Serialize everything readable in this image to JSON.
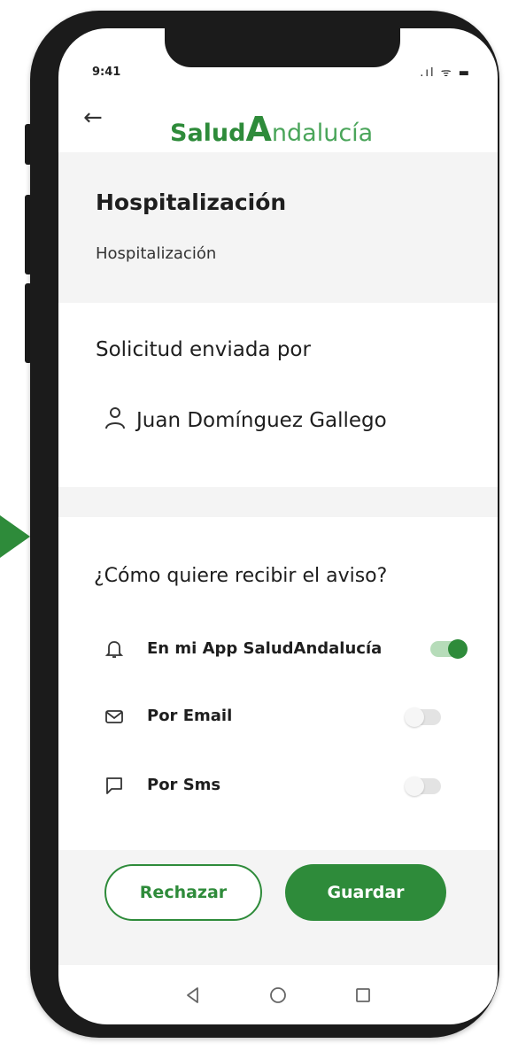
{
  "status_bar": {
    "time": "9:41",
    "icons": ".ıl ᯤ ▬"
  },
  "header": {
    "back_icon": "back-arrow-icon",
    "logo_part1": "Salud",
    "logo_part2": "A",
    "logo_part3": "ndalucía"
  },
  "section": {
    "title": "Hospitalización",
    "subtitle": "Hospitalización"
  },
  "sender": {
    "label": "Solicitud enviada por",
    "name": "Juan Domínguez Gallego"
  },
  "notify": {
    "question": "¿Cómo quiere recibir el aviso?",
    "options": [
      {
        "label": "En mi App SaludAndalucía",
        "icon": "bell-icon",
        "enabled": true
      },
      {
        "label": "Por Email",
        "icon": "mail-icon",
        "enabled": false
      },
      {
        "label": "Por Sms",
        "icon": "chat-icon",
        "enabled": false
      }
    ]
  },
  "actions": {
    "reject_label": "Rechazar",
    "save_label": "Guardar"
  },
  "colors": {
    "brand": "#2e8b3a",
    "panel": "#f4f4f4"
  }
}
